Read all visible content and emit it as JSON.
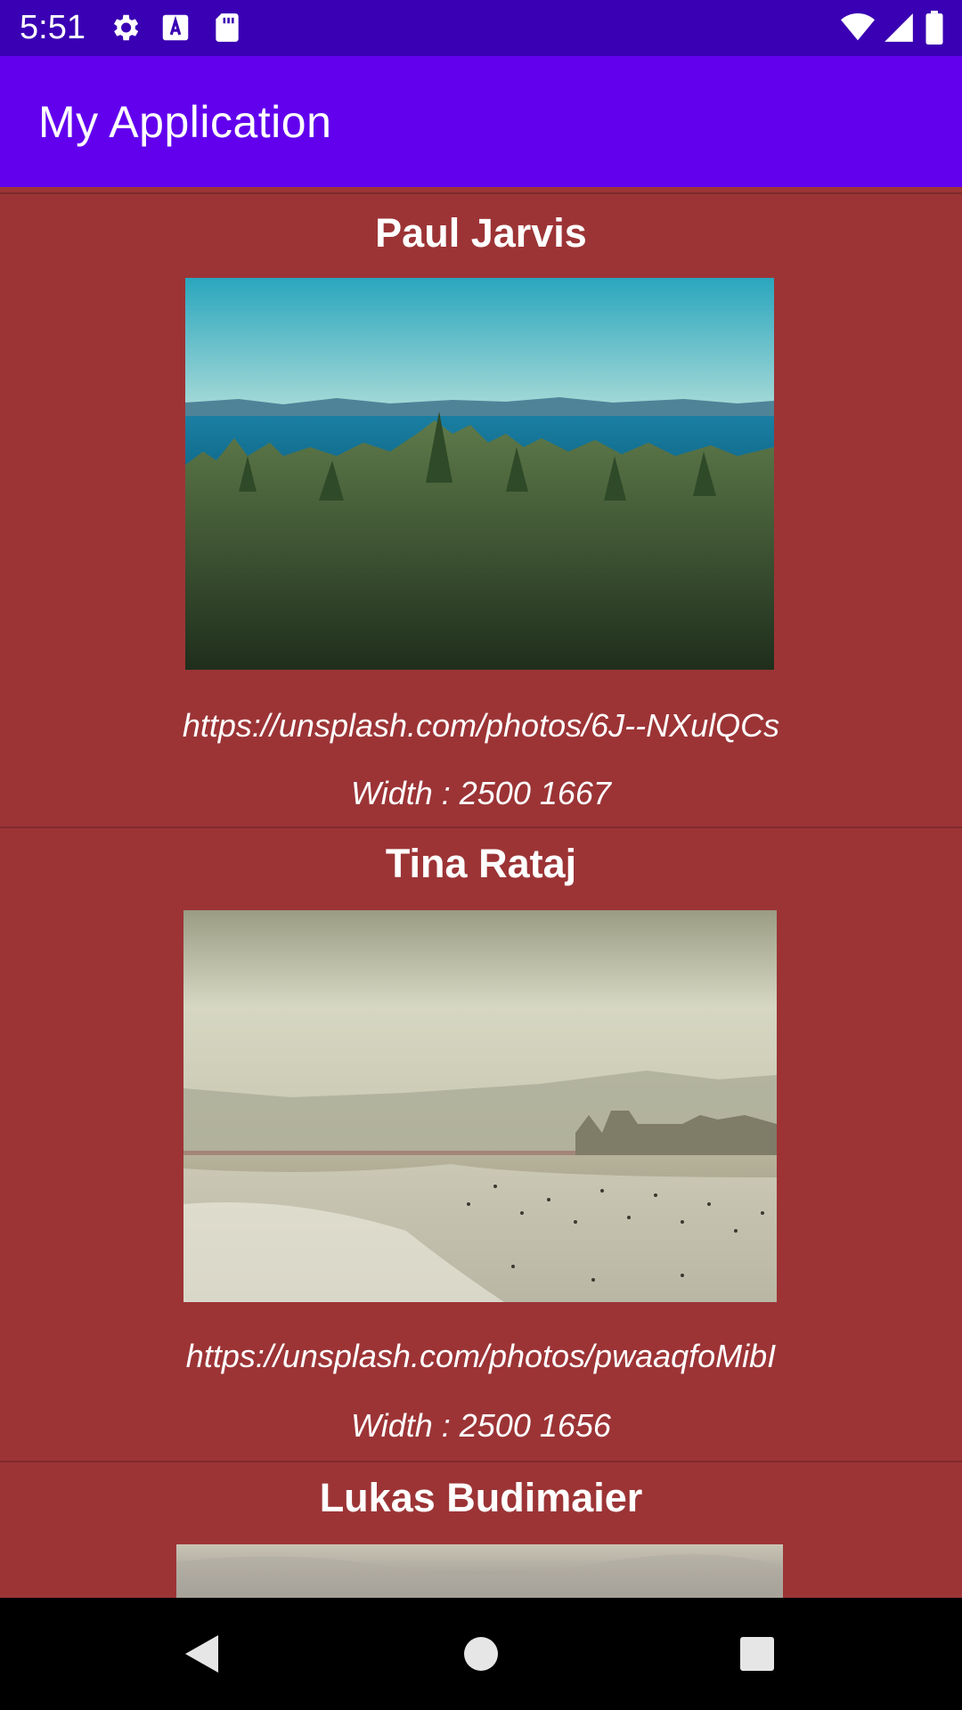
{
  "status_bar": {
    "time": "5:51",
    "icons": [
      "settings-icon",
      "a-keyboard-icon",
      "sd-card-icon",
      "wifi-icon",
      "signal-icon",
      "battery-icon"
    ]
  },
  "app_bar": {
    "title": "My Application"
  },
  "colors": {
    "status_bar": "#3a00b3",
    "app_bar": "#6200ee",
    "list_bg": "#9c3436"
  },
  "cards": [
    {
      "author": "Paul Jarvis",
      "url": "https://unsplash.com/photos/6J--NXulQCs",
      "size": "Width : 2500  1667"
    },
    {
      "author": "Tina Rataj",
      "url": "https://unsplash.com/photos/pwaaqfoMibI",
      "size": "Width : 2500  1656"
    },
    {
      "author": "Lukas Budimaier"
    }
  ],
  "nav": {
    "back": "back-icon",
    "home": "home-icon",
    "recents": "recents-icon"
  }
}
